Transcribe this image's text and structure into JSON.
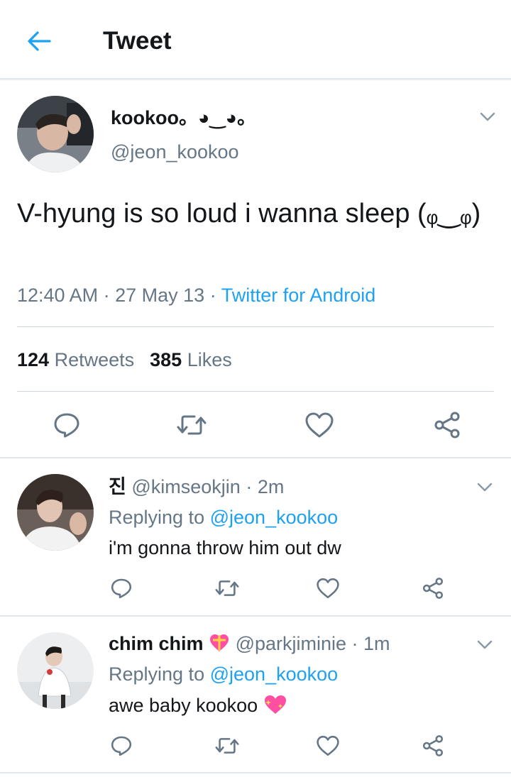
{
  "header": {
    "title": "Tweet"
  },
  "tweet": {
    "display_name": "kookoo。◕‿◕。",
    "handle": "@jeon_kookoo",
    "text": "V-hyung is so loud i wanna sleep (ᵩ‿ᵩ)",
    "time": "12:40 AM",
    "date": "27 May 13",
    "source": "Twitter for Android",
    "retweets_count": "124",
    "retweets_label": "Retweets",
    "likes_count": "385",
    "likes_label": "Likes"
  },
  "replies": [
    {
      "display_name": "진",
      "handle": "@kimseokjin",
      "time": "2m",
      "replying_prefix": "Replying to",
      "replying_to": "@jeon_kookoo",
      "text": "i'm gonna throw him out dw"
    },
    {
      "display_name": "chim chim",
      "handle": "@parkjiminie",
      "time": "1m",
      "replying_prefix": "Replying to",
      "replying_to": "@jeon_kookoo",
      "text": "awe baby kookoo"
    }
  ],
  "colors": {
    "accent": "#1da1f2",
    "secondary_text": "#657786",
    "primary_text": "#14171a",
    "divider": "#e1e8ed",
    "heart_emoji": "#ff4fa3"
  },
  "icons": [
    "back-arrow-icon",
    "chevron-down-icon",
    "reply-icon",
    "retweet-icon",
    "like-icon",
    "share-icon",
    "heart-ribbon-emoji-icon",
    "sparkling-heart-emoji-icon"
  ]
}
